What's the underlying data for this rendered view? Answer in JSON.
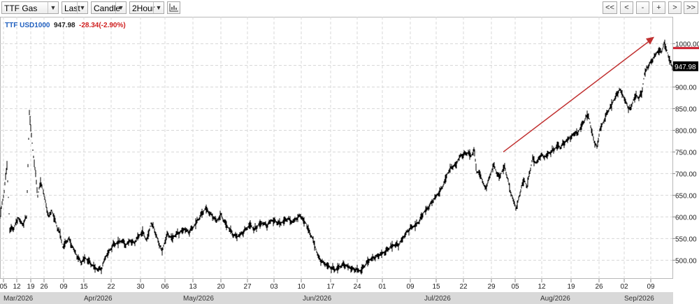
{
  "toolbar": {
    "symbol": "TTF Gas",
    "price_type": "Last",
    "chart_style": "Candle",
    "interval": "2Hour",
    "chart_icon": "bar-chart-icon",
    "nav_buttons": [
      "<<",
      "<",
      "-",
      "+",
      ">",
      ">>"
    ]
  },
  "legend": {
    "symbol": "TTF USD1000",
    "last": "947.98",
    "change": "-28.34(-2.90%)",
    "symbol_color": "#1f5fbf",
    "change_color": "#d02020"
  },
  "colors": {
    "price_line": "#000000",
    "arrow": "#c03030",
    "level_line": "#cc1a2a",
    "grid": "#d8d8d8",
    "axis_band": "#d9d9d9",
    "last_badge": "#000000"
  },
  "chart_data": {
    "type": "candlestick",
    "y_axis": {
      "position": "right",
      "ylim": [
        465,
        1030
      ],
      "ticks": [
        500,
        550,
        600,
        650,
        700,
        750,
        800,
        850,
        900,
        950,
        1000
      ],
      "tick_labels": [
        "500.00",
        "550.00",
        "600.00",
        "650.00",
        "700.00",
        "750.00",
        "800.00",
        "850.00",
        "900.00",
        "950.00",
        "1000.00"
      ]
    },
    "x_axis": {
      "day_labels": [
        "05",
        "12",
        "19",
        "26",
        "09",
        "15",
        "22",
        "30",
        "06",
        "13",
        "20",
        "27",
        "03",
        "10",
        "17",
        "24",
        "01",
        "09",
        "15",
        "22",
        "29",
        "05",
        "12",
        "19",
        "26",
        "02",
        "09"
      ],
      "month_labels": [
        "Mar/2026",
        "Apr/2026",
        "May/2026",
        "Jun/2026",
        "Jul/2026",
        "Aug/2026",
        "Sep/2026"
      ]
    },
    "price_path": [
      [
        0,
        600
      ],
      [
        6,
        660
      ],
      [
        10,
        720
      ],
      [
        14,
        570
      ],
      [
        20,
        575
      ],
      [
        26,
        598
      ],
      [
        32,
        582
      ],
      [
        38,
        600
      ],
      [
        42,
        840
      ],
      [
        46,
        770
      ],
      [
        50,
        710
      ],
      [
        54,
        650
      ],
      [
        58,
        680
      ],
      [
        62,
        660
      ],
      [
        66,
        625
      ],
      [
        70,
        600
      ],
      [
        74,
        615
      ],
      [
        78,
        595
      ],
      [
        82,
        575
      ],
      [
        86,
        560
      ],
      [
        90,
        530
      ],
      [
        94,
        540
      ],
      [
        98,
        550
      ],
      [
        104,
        530
      ],
      [
        110,
        510
      ],
      [
        116,
        495
      ],
      [
        122,
        505
      ],
      [
        128,
        495
      ],
      [
        134,
        485
      ],
      [
        140,
        478
      ],
      [
        146,
        482
      ],
      [
        150,
        505
      ],
      [
        156,
        520
      ],
      [
        162,
        535
      ],
      [
        168,
        540
      ],
      [
        174,
        545
      ],
      [
        180,
        535
      ],
      [
        186,
        545
      ],
      [
        192,
        540
      ],
      [
        198,
        555
      ],
      [
        204,
        565
      ],
      [
        210,
        545
      ],
      [
        216,
        585
      ],
      [
        220,
        575
      ],
      [
        226,
        545
      ],
      [
        232,
        520
      ],
      [
        236,
        545
      ],
      [
        240,
        560
      ],
      [
        246,
        550
      ],
      [
        252,
        560
      ],
      [
        258,
        565
      ],
      [
        264,
        572
      ],
      [
        270,
        565
      ],
      [
        276,
        575
      ],
      [
        282,
        590
      ],
      [
        288,
        605
      ],
      [
        294,
        620
      ],
      [
        298,
        612
      ],
      [
        304,
        602
      ],
      [
        310,
        590
      ],
      [
        316,
        605
      ],
      [
        322,
        585
      ],
      [
        328,
        572
      ],
      [
        334,
        558
      ],
      [
        340,
        555
      ],
      [
        346,
        562
      ],
      [
        352,
        572
      ],
      [
        358,
        582
      ],
      [
        364,
        570
      ],
      [
        370,
        582
      ],
      [
        376,
        586
      ],
      [
        382,
        580
      ],
      [
        388,
        592
      ],
      [
        394,
        590
      ],
      [
        400,
        584
      ],
      [
        406,
        590
      ],
      [
        412,
        596
      ],
      [
        418,
        588
      ],
      [
        424,
        596
      ],
      [
        430,
        604
      ],
      [
        434,
        590
      ],
      [
        438,
        585
      ],
      [
        442,
        565
      ],
      [
        446,
        555
      ],
      [
        450,
        535
      ],
      [
        456,
        505
      ],
      [
        462,
        495
      ],
      [
        468,
        488
      ],
      [
        474,
        482
      ],
      [
        480,
        478
      ],
      [
        486,
        485
      ],
      [
        492,
        490
      ],
      [
        498,
        485
      ],
      [
        504,
        480
      ],
      [
        510,
        478
      ],
      [
        516,
        475
      ],
      [
        522,
        488
      ],
      [
        528,
        500
      ],
      [
        534,
        505
      ],
      [
        540,
        510
      ],
      [
        546,
        515
      ],
      [
        552,
        520
      ],
      [
        558,
        530
      ],
      [
        564,
        535
      ],
      [
        570,
        535
      ],
      [
        576,
        550
      ],
      [
        582,
        565
      ],
      [
        588,
        575
      ],
      [
        594,
        580
      ],
      [
        600,
        590
      ],
      [
        606,
        610
      ],
      [
        612,
        620
      ],
      [
        618,
        635
      ],
      [
        624,
        648
      ],
      [
        630,
        660
      ],
      [
        636,
        680
      ],
      [
        640,
        700
      ],
      [
        646,
        715
      ],
      [
        652,
        720
      ],
      [
        658,
        740
      ],
      [
        664,
        745
      ],
      [
        670,
        748
      ],
      [
        674,
        740
      ],
      [
        678,
        755
      ],
      [
        682,
        705
      ],
      [
        686,
        700
      ],
      [
        690,
        685
      ],
      [
        694,
        665
      ],
      [
        698,
        680
      ],
      [
        702,
        700
      ],
      [
        706,
        720
      ],
      [
        710,
        705
      ],
      [
        714,
        690
      ],
      [
        718,
        705
      ],
      [
        722,
        715
      ],
      [
        726,
        690
      ],
      [
        730,
        660
      ],
      [
        734,
        640
      ],
      [
        738,
        620
      ],
      [
        742,
        640
      ],
      [
        746,
        670
      ],
      [
        750,
        685
      ],
      [
        754,
        670
      ],
      [
        758,
        705
      ],
      [
        762,
        735
      ],
      [
        766,
        725
      ],
      [
        770,
        730
      ],
      [
        774,
        745
      ],
      [
        778,
        738
      ],
      [
        782,
        742
      ],
      [
        786,
        748
      ],
      [
        790,
        752
      ],
      [
        794,
        758
      ],
      [
        798,
        765
      ],
      [
        802,
        760
      ],
      [
        806,
        770
      ],
      [
        810,
        775
      ],
      [
        814,
        782
      ],
      [
        818,
        785
      ],
      [
        822,
        795
      ],
      [
        826,
        792
      ],
      [
        830,
        805
      ],
      [
        834,
        815
      ],
      [
        838,
        830
      ],
      [
        842,
        835
      ],
      [
        846,
        800
      ],
      [
        850,
        775
      ],
      [
        854,
        760
      ],
      [
        858,
        800
      ],
      [
        862,
        815
      ],
      [
        866,
        830
      ],
      [
        870,
        845
      ],
      [
        874,
        855
      ],
      [
        878,
        870
      ],
      [
        882,
        880
      ],
      [
        886,
        895
      ],
      [
        890,
        885
      ],
      [
        894,
        870
      ],
      [
        898,
        855
      ],
      [
        902,
        848
      ],
      [
        906,
        870
      ],
      [
        910,
        880
      ],
      [
        914,
        875
      ],
      [
        918,
        885
      ],
      [
        922,
        930
      ],
      [
        926,
        945
      ],
      [
        930,
        955
      ],
      [
        934,
        965
      ],
      [
        938,
        975
      ],
      [
        942,
        985
      ],
      [
        946,
        980
      ],
      [
        950,
        1000
      ],
      [
        954,
        985
      ],
      [
        958,
        960
      ],
      [
        962,
        948
      ]
    ]
  }
}
